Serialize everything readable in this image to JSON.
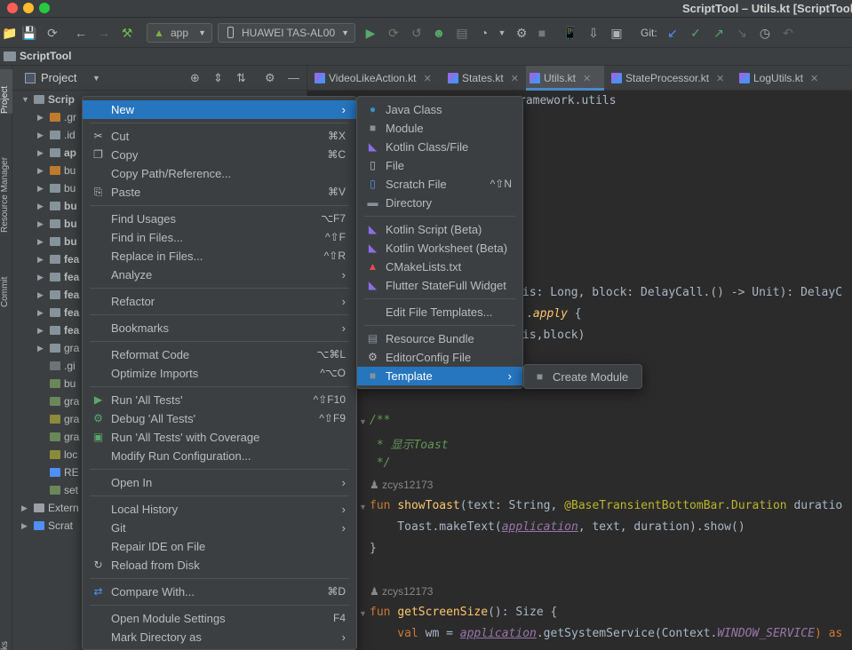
{
  "window": {
    "title": "ScriptTool – Utils.kt [ScriptTool]"
  },
  "toolbar": {
    "run_config": "app",
    "device": "HUAWEI TAS-AL00",
    "git_label": "Git:"
  },
  "breadcrumb": {
    "project": "ScriptTool"
  },
  "left_strip": {
    "project": "Project",
    "resource_manager": "Resource Manager",
    "commit": "Commit",
    "bottom": "ks"
  },
  "project_panel": {
    "title": "Project",
    "tree": [
      {
        "label": "Scrip",
        "chev": "down",
        "indent": 0,
        "icon": "#87939a",
        "bold": true
      },
      {
        "label": ".gr",
        "chev": "right",
        "indent": 1,
        "icon": "#c07a2c"
      },
      {
        "label": ".id",
        "chev": "right",
        "indent": 1,
        "icon": "#87939a"
      },
      {
        "label": "ap",
        "chev": "right",
        "indent": 1,
        "icon": "#87939a",
        "bold": true
      },
      {
        "label": "bu",
        "chev": "right",
        "indent": 1,
        "icon": "#c07a2c"
      },
      {
        "label": "bu",
        "chev": "right",
        "indent": 1,
        "icon": "#87939a"
      },
      {
        "label": "bu",
        "chev": "right",
        "indent": 1,
        "icon": "#87939a",
        "bold": true
      },
      {
        "label": "bu",
        "chev": "right",
        "indent": 1,
        "icon": "#87939a",
        "bold": true
      },
      {
        "label": "bu",
        "chev": "right",
        "indent": 1,
        "icon": "#87939a",
        "bold": true
      },
      {
        "label": "fea",
        "chev": "right",
        "indent": 1,
        "icon": "#87939a",
        "bold": true
      },
      {
        "label": "fea",
        "chev": "right",
        "indent": 1,
        "icon": "#87939a",
        "bold": true
      },
      {
        "label": "fea",
        "chev": "right",
        "indent": 1,
        "icon": "#87939a",
        "bold": true
      },
      {
        "label": "fea",
        "chev": "right",
        "indent": 1,
        "icon": "#87939a",
        "bold": true
      },
      {
        "label": "fea",
        "chev": "right",
        "indent": 1,
        "icon": "#87939a",
        "bold": true
      },
      {
        "label": "gra",
        "chev": "right",
        "indent": 1,
        "icon": "#87939a"
      },
      {
        "label": ".gi",
        "chev": "",
        "indent": 1,
        "icon": "#6d7378"
      },
      {
        "label": "bu",
        "chev": "",
        "indent": 1,
        "icon": "#6a8759"
      },
      {
        "label": "gra",
        "chev": "",
        "indent": 1,
        "icon": "#6a8759"
      },
      {
        "label": "gra",
        "chev": "",
        "indent": 1,
        "icon": "#8b8b3a"
      },
      {
        "label": "gra",
        "chev": "",
        "indent": 1,
        "icon": "#6a8759"
      },
      {
        "label": "loc",
        "chev": "",
        "indent": 1,
        "icon": "#8b8b3a"
      },
      {
        "label": "RE",
        "chev": "",
        "indent": 1,
        "icon": "#4f8ff7"
      },
      {
        "label": "set",
        "chev": "",
        "indent": 1,
        "icon": "#6a8759"
      },
      {
        "label": "Extern",
        "chev": "right",
        "indent": 0,
        "icon": "#9aa0a6"
      },
      {
        "label": "Scrat",
        "chev": "right",
        "indent": 0,
        "icon": "#4f8ff7"
      }
    ]
  },
  "tabs": [
    {
      "label": "VideoLikeAction.kt",
      "active": false
    },
    {
      "label": "States.kt",
      "active": false
    },
    {
      "label": "Utils.kt",
      "active": true
    },
    {
      "label": "StateProcessor.kt",
      "active": false
    },
    {
      "label": "LogUtils.kt",
      "active": false
    }
  ],
  "editor": {
    "pkg_tail": "ramework.utils",
    "line_delay_params": "is: Long, block: DelayCall.() -> Unit): DelayC",
    "line_apply_dot": ".",
    "line_apply_kw": "apply",
    "line_apply_brace": " {",
    "line_block": "is,block)",
    "doc_open": "/**",
    "doc_text": " * 显示Toast",
    "doc_close": " */",
    "author1": "zcys12173",
    "toast_fun_kw": "fun ",
    "toast_fun_name": "showToast",
    "toast_params_a": "(text: String, ",
    "toast_ann": "@BaseTransientBottomBar.",
    "toast_ann_dur": "Duration",
    "toast_params_b": " duratio",
    "toast_body_a": "    Toast.makeText(",
    "toast_body_app": "application",
    "toast_body_b": ", text, duration).show()",
    "close_brace": "}",
    "author2": "zcys12173",
    "screen_fun_kw": "fun ",
    "screen_fun_name": "getScreenSize",
    "screen_fun_rest": "(): Size {",
    "wm_val": "    val ",
    "wm_a": "wm = ",
    "wm_app": "application",
    "wm_b": ".getSystemService(Context.",
    "wm_const": "WINDOW_SERVICE",
    "wm_c": ") as"
  },
  "context_menu": {
    "items": [
      {
        "label": "New",
        "shortcut": "",
        "submenu": true,
        "highlight": true,
        "icon": ""
      },
      {
        "sep": true
      },
      {
        "label": "Cut",
        "shortcut": "⌘X",
        "icon": "scissors"
      },
      {
        "label": "Copy",
        "shortcut": "⌘C",
        "icon": "copy"
      },
      {
        "label": "Copy Path/Reference...",
        "shortcut": ""
      },
      {
        "label": "Paste",
        "shortcut": "⌘V",
        "icon": "paste"
      },
      {
        "sep": true
      },
      {
        "label": "Find Usages",
        "shortcut": "⌥F7"
      },
      {
        "label": "Find in Files...",
        "shortcut": "^⇧F"
      },
      {
        "label": "Replace in Files...",
        "shortcut": "^⇧R"
      },
      {
        "label": "Analyze",
        "shortcut": "",
        "submenu": true
      },
      {
        "sep": true
      },
      {
        "label": "Refactor",
        "shortcut": "",
        "submenu": true
      },
      {
        "sep": true
      },
      {
        "label": "Bookmarks",
        "shortcut": "",
        "submenu": true
      },
      {
        "sep": true
      },
      {
        "label": "Reformat Code",
        "shortcut": "⌥⌘L"
      },
      {
        "label": "Optimize Imports",
        "shortcut": "^⌥O"
      },
      {
        "sep": true
      },
      {
        "label": "Run 'All Tests'",
        "shortcut": "^⇧F10",
        "icon": "run"
      },
      {
        "label": "Debug 'All Tests'",
        "shortcut": "^⇧F9",
        "icon": "debug"
      },
      {
        "label": "Run 'All Tests' with Coverage",
        "shortcut": "",
        "icon": "coverage"
      },
      {
        "label": "Modify Run Configuration...",
        "shortcut": ""
      },
      {
        "sep": true
      },
      {
        "label": "Open In",
        "shortcut": "",
        "submenu": true
      },
      {
        "sep": true
      },
      {
        "label": "Local History",
        "shortcut": "",
        "submenu": true
      },
      {
        "label": "Git",
        "shortcut": "",
        "submenu": true
      },
      {
        "label": "Repair IDE on File",
        "shortcut": ""
      },
      {
        "label": "Reload from Disk",
        "shortcut": "",
        "icon": "reload"
      },
      {
        "sep": true
      },
      {
        "label": "Compare With...",
        "shortcut": "⌘D",
        "icon": "compare"
      },
      {
        "sep": true
      },
      {
        "label": "Open Module Settings",
        "shortcut": "F4"
      },
      {
        "label": "Mark Directory as",
        "shortcut": "",
        "submenu": true
      }
    ]
  },
  "new_submenu": {
    "items": [
      {
        "label": "Java Class",
        "shortcut": "",
        "icon": "java"
      },
      {
        "label": "Module",
        "shortcut": "",
        "icon": "module"
      },
      {
        "label": "Kotlin Class/File",
        "shortcut": "",
        "icon": "kotlin"
      },
      {
        "label": "File",
        "shortcut": "",
        "icon": "file"
      },
      {
        "label": "Scratch File",
        "shortcut": "^⇧N",
        "icon": "scratch"
      },
      {
        "label": "Directory",
        "shortcut": "",
        "icon": "folder"
      },
      {
        "sep": true
      },
      {
        "label": "Kotlin Script (Beta)",
        "shortcut": "",
        "icon": "kotlin"
      },
      {
        "label": "Kotlin Worksheet (Beta)",
        "shortcut": "",
        "icon": "kotlin"
      },
      {
        "label": "CMakeLists.txt",
        "shortcut": "",
        "icon": "cmake"
      },
      {
        "label": "Flutter StateFull Widget",
        "shortcut": "",
        "icon": "flutter"
      },
      {
        "sep": true
      },
      {
        "label": "Edit File Templates...",
        "shortcut": ""
      },
      {
        "sep": true
      },
      {
        "label": "Resource Bundle",
        "shortcut": "",
        "icon": "bundle"
      },
      {
        "label": "EditorConfig File",
        "shortcut": "",
        "icon": "gear"
      },
      {
        "label": "Template",
        "shortcut": "",
        "submenu": true,
        "highlight": true,
        "icon": "template"
      }
    ]
  },
  "template_submenu": {
    "items": [
      {
        "label": "Create Module",
        "icon": "module"
      }
    ]
  }
}
